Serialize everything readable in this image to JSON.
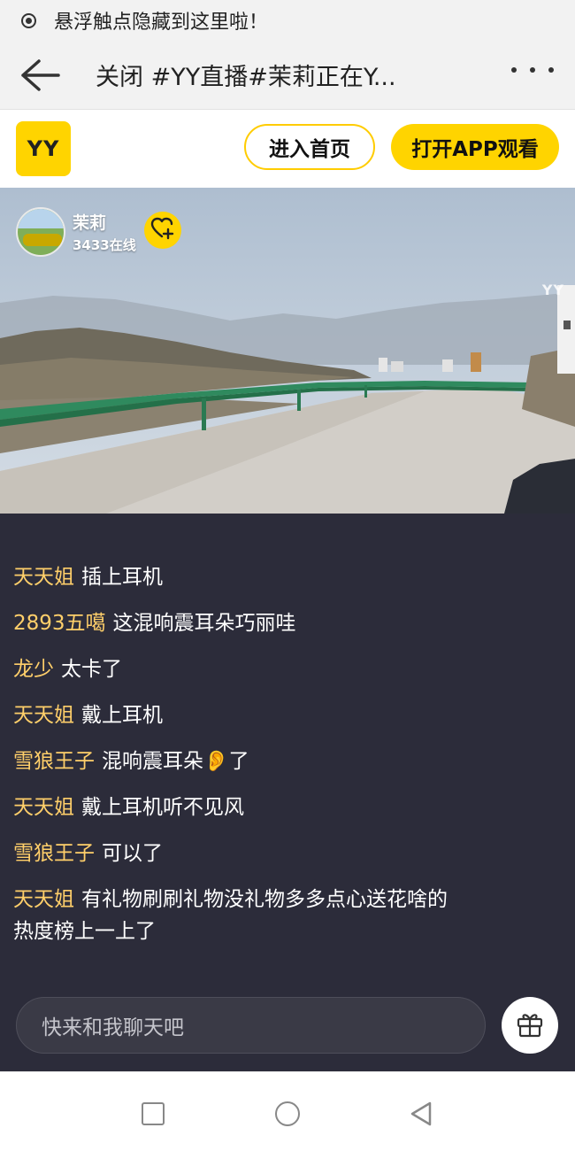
{
  "hint_bar": {
    "text": "悬浮触点隐藏到这里啦！"
  },
  "nav": {
    "close_label": "关闭",
    "title": "#YY直播#茉莉正在Y..."
  },
  "header": {
    "logo_text": "YY",
    "home_button": "进入首页",
    "open_app_button": "打开APP观看"
  },
  "streamer": {
    "name": "茉莉",
    "online": "3433在线"
  },
  "video": {
    "watermark": "YY"
  },
  "chat": {
    "messages": [
      {
        "user": "天天姐",
        "text": "插上耳机"
      },
      {
        "user": "2893五噶",
        "text": "这混响震耳朵巧丽哇"
      },
      {
        "user": "龙少",
        "text": "太卡了"
      },
      {
        "user": "天天姐",
        "text": "戴上耳机"
      },
      {
        "user": "雪狼王子",
        "text": "混响震耳朵👂了"
      },
      {
        "user": "天天姐",
        "text": "戴上耳机听不见风"
      },
      {
        "user": "雪狼王子",
        "text": "可以了"
      },
      {
        "user": "天天姐",
        "text": "有礼物刷刷礼物没礼物多多点心送花啥的热度榜上一上了"
      }
    ],
    "input_placeholder": "快来和我聊天吧"
  },
  "colors": {
    "accent": "#ffd400",
    "chat_bg": "#2c2c3a",
    "username": "#ffcf6a"
  },
  "icons": {
    "hint": "target-icon",
    "back": "arrow-left-icon",
    "more": "more-dots-icon",
    "follow": "heart-plus-icon",
    "gift": "gift-icon",
    "android_recent": "square-icon",
    "android_home": "circle-icon",
    "android_back": "triangle-back-icon"
  }
}
